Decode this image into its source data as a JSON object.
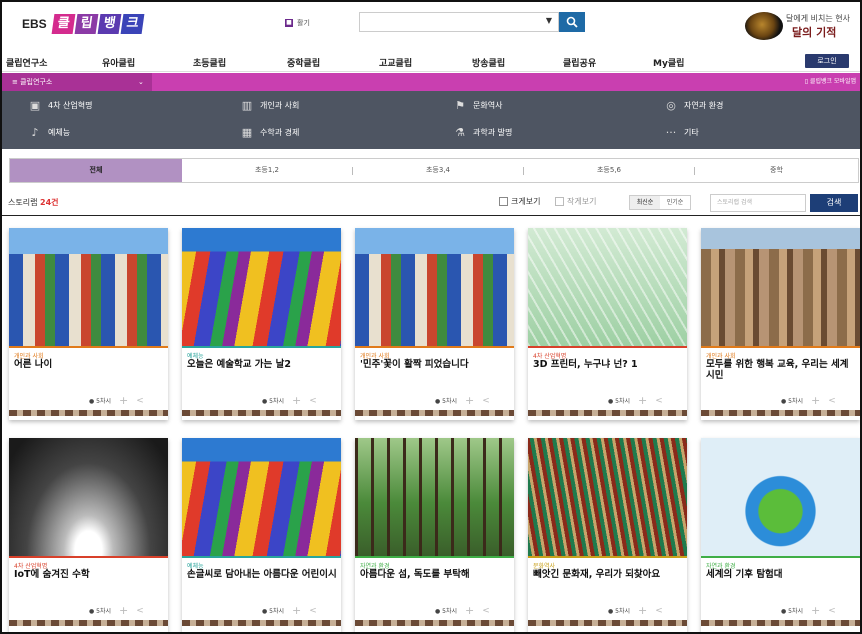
{
  "header": {
    "logo_prefix": "EBS",
    "logo_blocks": [
      "클",
      "립",
      "뱅",
      "크"
    ],
    "guide_label": "활기",
    "promo_subtitle": "달에게 비치는 현사",
    "promo_title": "달의 기적"
  },
  "nav": {
    "items": [
      "클립연구소",
      "유아클립",
      "초등클립",
      "중학클립",
      "고교클립",
      "방송클립",
      "클립공유",
      "My클립"
    ],
    "login": "로그인"
  },
  "category": {
    "selected": "클립연구소",
    "mobile_label": "클립뱅크 모바일앱",
    "items": [
      {
        "icon": "vr-icon",
        "label": "4차 산업혁명"
      },
      {
        "icon": "people-icon",
        "label": "개인과 사회"
      },
      {
        "icon": "flag-icon",
        "label": "문화역사"
      },
      {
        "icon": "globe-icon",
        "label": "자연과 환경"
      },
      {
        "icon": "art-icon",
        "label": "예체능"
      },
      {
        "icon": "grid-icon",
        "label": "수학과 경제"
      },
      {
        "icon": "flask-icon",
        "label": "과학과 발명"
      },
      {
        "icon": "more-icon",
        "label": "기타"
      }
    ]
  },
  "tabs": [
    "전체",
    "초등1,2",
    "초등3,4",
    "초등5,6",
    "중학"
  ],
  "toolbar": {
    "count_label": "스토리랩",
    "count_value": "24건",
    "large_view": "크게보기",
    "small_view": "작게보기",
    "sort_latest": "최신순",
    "sort_popular": "인기순",
    "search_placeholder": "스토리랩 검색",
    "search_button": "검색"
  },
  "cards": [
    {
      "category": "개인과 사회",
      "category_color": "#e07a1a",
      "title": "어른 나이",
      "meta": "5차시",
      "image": "hundert"
    },
    {
      "category": "예체능",
      "category_color": "#2aa59c",
      "title": "오늘은 예술학교 가는 날2",
      "meta": "5차시",
      "image": "colorful"
    },
    {
      "category": "개인과 사회",
      "category_color": "#e07a1a",
      "title": "'민주'꽃이 활짝 피었습니다",
      "meta": "5차시",
      "image": "hundert"
    },
    {
      "category": "4차 산업혁명",
      "category_color": "#d8402a",
      "title": "3D 프린터, 누구냐 넌? 1",
      "meta": "5차시",
      "image": "sketch"
    },
    {
      "category": "개인과 사회",
      "category_color": "#e07a1a",
      "title": "모두를 위한 행복 교육, 우리는 세계시민",
      "meta": "5차시",
      "image": "city"
    },
    {
      "category": "4차 산업혁명",
      "category_color": "#d8402a",
      "title": "IoT에 숨겨진 수학",
      "meta": "5차시",
      "image": "iot"
    },
    {
      "category": "예체능",
      "category_color": "#2aa59c",
      "title": "손글씨로 담아내는 아름다운 어린이시",
      "meta": "5차시",
      "image": "colorful"
    },
    {
      "category": "자연과 환경",
      "category_color": "#3fae46",
      "title": "아름다운 섬, 독도를 부탁해",
      "meta": "5차시",
      "image": "forest"
    },
    {
      "category": "문화역사",
      "category_color": "#c9a11a",
      "title": "빼앗긴 문화재, 우리가 되찾아요",
      "meta": "5차시",
      "image": "roof"
    },
    {
      "category": "자연과 환경",
      "category_color": "#3fae46",
      "title": "세계의 기후 탐험대",
      "meta": "5차시",
      "image": "globe"
    }
  ],
  "colors": {
    "accent_purple": "#c93fb0",
    "nav_dark": "#4e5562",
    "search_blue": "#1e6aa6",
    "button_navy": "#1d3e77"
  }
}
